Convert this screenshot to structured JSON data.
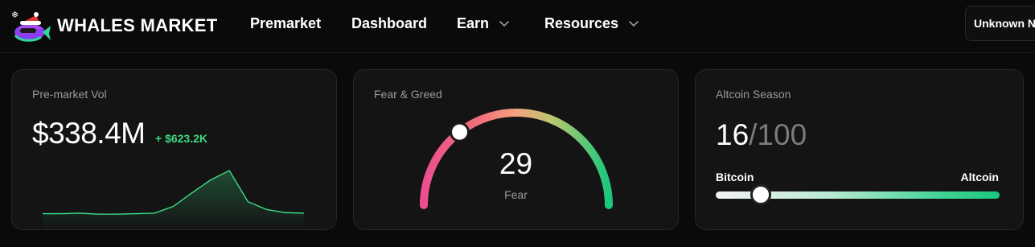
{
  "header": {
    "brand": "WHALES MARKET",
    "nav": [
      {
        "label": "Premarket",
        "dropdown": false
      },
      {
        "label": "Dashboard",
        "dropdown": false
      },
      {
        "label": "Earn",
        "dropdown": true
      },
      {
        "label": "Resources",
        "dropdown": true
      }
    ],
    "account_button": "Unknown N"
  },
  "cards": {
    "premarket": {
      "title": "Pre-market Vol",
      "value": "$338.4M",
      "delta": "+ $623.2K",
      "sparkline": [
        10,
        10,
        11,
        9,
        9,
        10,
        11,
        24,
        50,
        75,
        93,
        33,
        18,
        12,
        11
      ],
      "color": "#3ddc84"
    },
    "fear_greed": {
      "title": "Fear & Greed",
      "value": "29",
      "label": "Fear",
      "index": 29
    },
    "altcoin": {
      "title": "Altcoin Season",
      "value": "16",
      "total": "/100",
      "left_label": "Bitcoin",
      "right_label": "Altcoin",
      "index": 16
    }
  }
}
